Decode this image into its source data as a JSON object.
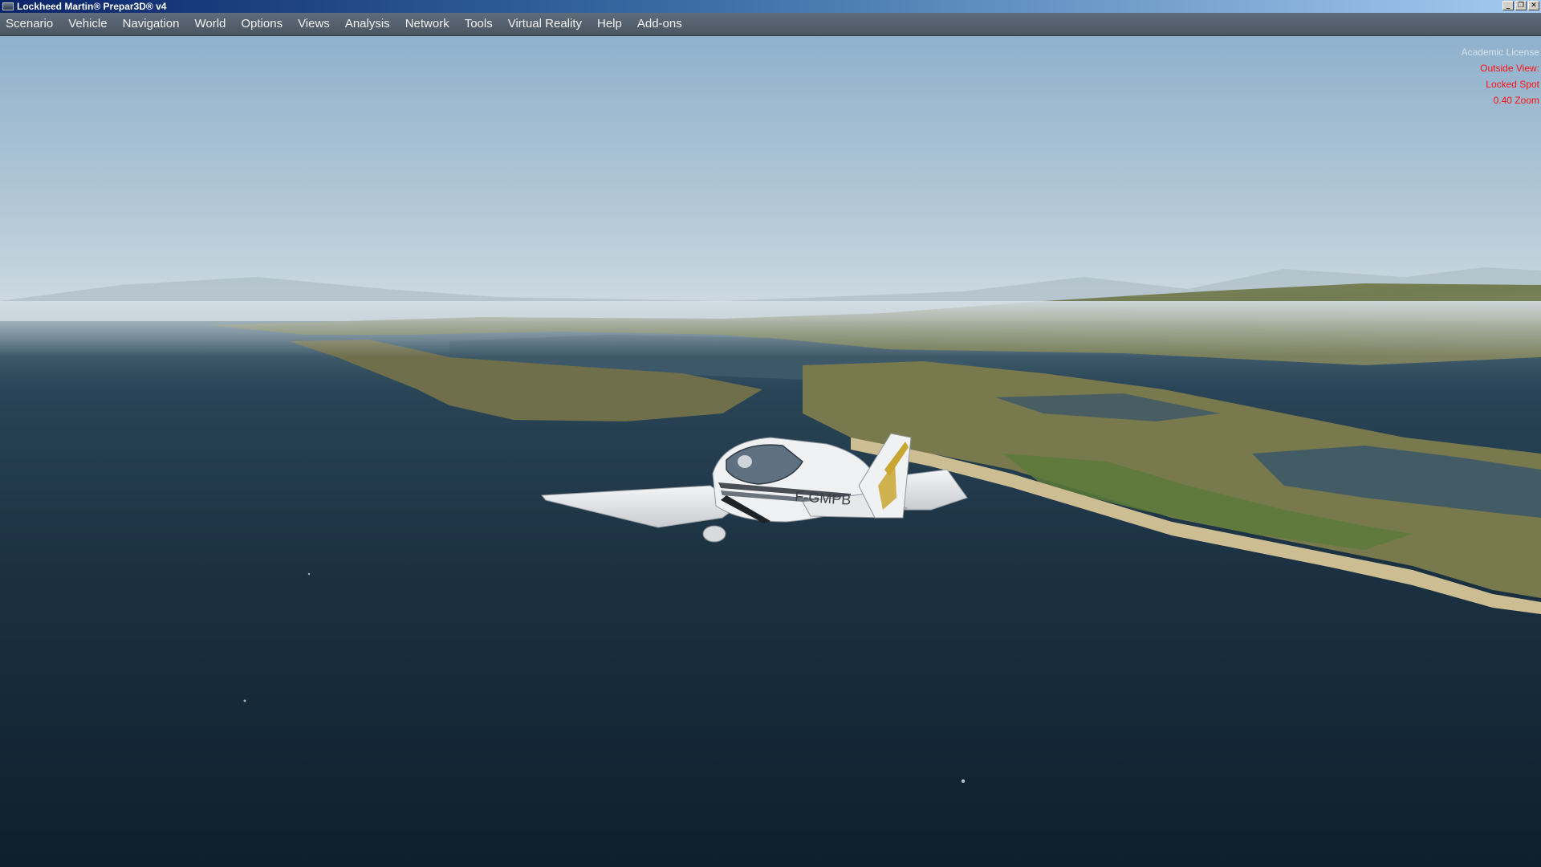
{
  "window": {
    "title": "Lockheed Martin® Prepar3D® v4",
    "buttons": {
      "minimize": "_",
      "restore": "❐",
      "close": "✕"
    }
  },
  "menu": {
    "items": [
      {
        "label": "Scenario"
      },
      {
        "label": "Vehicle"
      },
      {
        "label": "Navigation"
      },
      {
        "label": "World"
      },
      {
        "label": "Options"
      },
      {
        "label": "Views"
      },
      {
        "label": "Analysis"
      },
      {
        "label": "Network"
      },
      {
        "label": "Tools"
      },
      {
        "label": "Virtual Reality"
      },
      {
        "label": "Help"
      },
      {
        "label": "Add-ons"
      }
    ]
  },
  "hud": {
    "license": "Academic License",
    "view_type": "Outside View:",
    "view_name": "Locked Spot",
    "zoom": "0.40 Zoom"
  },
  "aircraft": {
    "registration": "F-GMPB"
  },
  "colors": {
    "sky_top": "#8fb2cf",
    "sky_horizon": "#cfdbe3",
    "sea": "#1c3346",
    "land": "#6e7446",
    "beach": "#c9b88e",
    "hud_red": "#ff1010",
    "menubar": "#56626e"
  }
}
